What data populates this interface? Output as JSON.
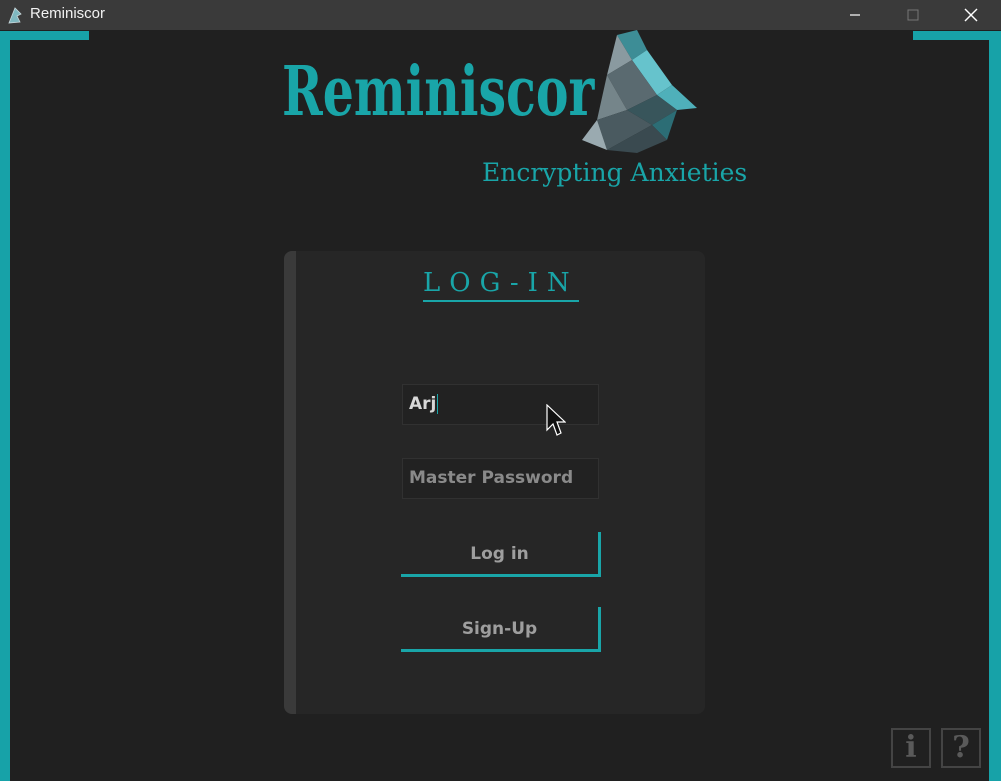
{
  "window": {
    "title": "Reminiscor"
  },
  "branding": {
    "logo_text": "Reminiscor",
    "tagline": "Encrypting Anxieties",
    "accent_color": "#17a2a8"
  },
  "login": {
    "heading": "LOG-IN",
    "username_value": "Arj",
    "password_placeholder": "Master Password",
    "login_label": "Log in",
    "signup_label": "Sign-Up"
  },
  "corner_buttons": {
    "info_label": "i",
    "help_label": "?"
  },
  "icons": [
    "app-icon",
    "minimize-icon",
    "maximize-icon",
    "close-icon",
    "mouse-cursor-icon",
    "info-icon",
    "help-icon"
  ]
}
